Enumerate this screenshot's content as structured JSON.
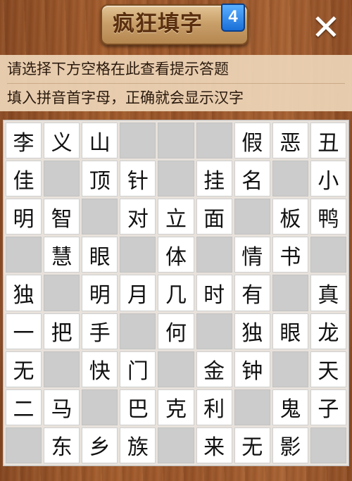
{
  "header": {
    "title": "疯狂填字",
    "level": "4",
    "close_label": "✕"
  },
  "hint": {
    "line1": "请选择下方空格在此查看提示答题",
    "line2": "填入拼音首字母，正确就会显示汉字"
  },
  "grid": {
    "rows": [
      [
        "李",
        "义",
        "山",
        "",
        "",
        "",
        "假",
        "恶",
        "丑"
      ],
      [
        "佳",
        "",
        "顶",
        "针",
        "",
        "挂",
        "名",
        "",
        "小"
      ],
      [
        "明",
        "智",
        "",
        "对",
        "立",
        "面",
        "",
        "板",
        "鸭"
      ],
      [
        "",
        "慧",
        "眼",
        "",
        "体",
        "",
        "情",
        "书",
        ""
      ],
      [
        "独",
        "",
        "明",
        "月",
        "几",
        "时",
        "有",
        "",
        "真"
      ],
      [
        "一",
        "把",
        "手",
        "",
        "何",
        "",
        "独",
        "眼",
        "龙"
      ],
      [
        "无",
        "",
        "快",
        "门",
        "",
        "金",
        "钟",
        "",
        "天"
      ],
      [
        "二",
        "马",
        "",
        "巴",
        "克",
        "利",
        "",
        "鬼",
        "子"
      ],
      [
        "",
        "东",
        "乡",
        "族",
        "",
        "来",
        "无",
        "影",
        ""
      ]
    ]
  }
}
